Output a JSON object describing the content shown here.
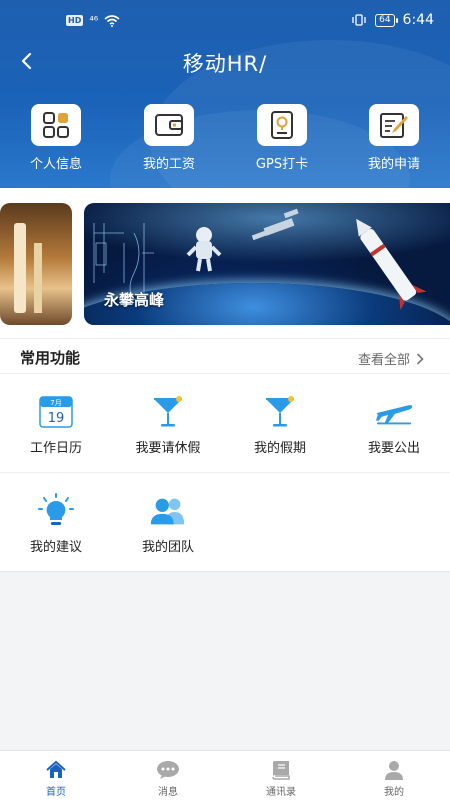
{
  "status_bar": {
    "network_badge": "HD",
    "signal": "⁴⁶",
    "battery": "64",
    "time": "6:44"
  },
  "header": {
    "title": "移动HR/",
    "back_icon": "chevron-left-icon"
  },
  "quick_actions": [
    {
      "label": "个人信息",
      "icon": "grid-squares-icon"
    },
    {
      "label": "我的工资",
      "icon": "wallet-icon"
    },
    {
      "label": "GPS打卡",
      "icon": "location-pin-icon"
    },
    {
      "label": "我的申请",
      "icon": "edit-note-icon"
    }
  ],
  "banner": {
    "caption": "永攀高峰"
  },
  "common_functions": {
    "title": "常用功能",
    "view_all": "查看全部",
    "items": [
      {
        "label": "工作日历",
        "icon": "calendar-icon",
        "calendar_month": "7月",
        "calendar_day": "19"
      },
      {
        "label": "我要请休假",
        "icon": "cocktail-icon"
      },
      {
        "label": "我的假期",
        "icon": "cocktail-icon"
      },
      {
        "label": "我要公出",
        "icon": "airplane-icon"
      },
      {
        "label": "我的建议",
        "icon": "lightbulb-icon"
      },
      {
        "label": "我的团队",
        "icon": "team-icon"
      }
    ]
  },
  "bottom_nav": [
    {
      "label": "首页",
      "icon": "home-icon",
      "active": true
    },
    {
      "label": "消息",
      "icon": "chat-bubble-icon",
      "active": false
    },
    {
      "label": "通讯录",
      "icon": "book-icon",
      "active": false
    },
    {
      "label": "我的",
      "icon": "user-icon",
      "active": false
    }
  ],
  "colors": {
    "primary": "#1a63b8",
    "accent_blue": "#2a9be8"
  }
}
